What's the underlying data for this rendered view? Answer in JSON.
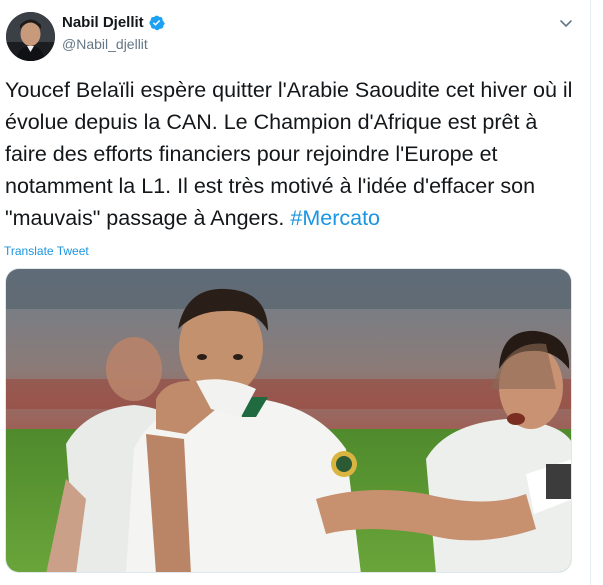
{
  "author": {
    "name": "Nabil Djellit",
    "handle": "@Nabil_djellit",
    "verified": true
  },
  "tweet": {
    "text": "Youcef Belaïli espère quitter l'Arabie Saoudite cet hiver où il évolue depuis la CAN. Le Champion d'Afrique est prêt à faire des efforts financiers pour rejoindre l'Europe et notamment la L1. Il est très motivé à l'idée d'effacer son \"mauvais\" passage à Angers. ",
    "hashtag": "#Mercato",
    "translate_label": "Translate Tweet"
  },
  "colors": {
    "link": "#1b95e0",
    "verified": "#1da1f2",
    "text": "#14171a",
    "muted": "#657786"
  },
  "icons": {
    "menu": "chevron-down-icon",
    "badge": "verified-badge-icon"
  }
}
